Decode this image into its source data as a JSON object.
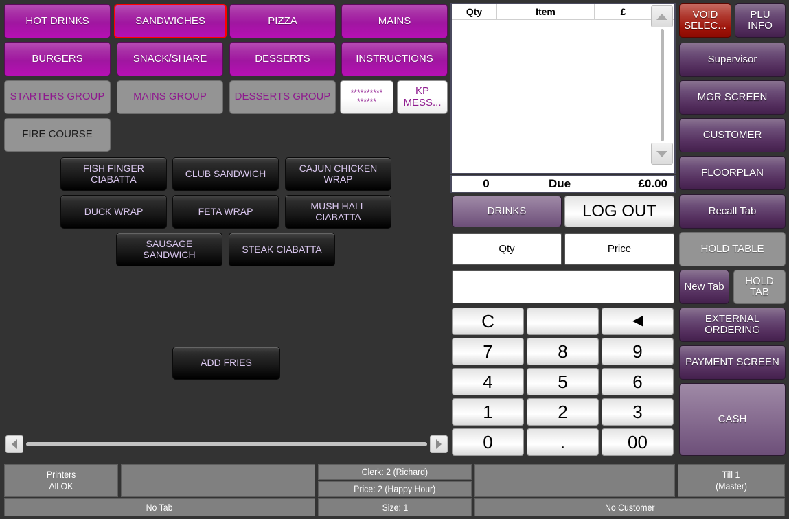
{
  "categories": [
    {
      "label": "HOT DRINKS",
      "selected": false
    },
    {
      "label": "SANDWICHES",
      "selected": true
    },
    {
      "label": "PIZZA",
      "selected": false
    },
    {
      "label": "MAINS",
      "selected": false
    },
    {
      "label": "BURGERS",
      "selected": false
    },
    {
      "label": "SNACK/SHARE",
      "selected": false
    },
    {
      "label": "DESSERTS",
      "selected": false
    },
    {
      "label": "INSTRUCTIONS",
      "selected": false
    }
  ],
  "groups": [
    {
      "label": "STARTERS GROUP"
    },
    {
      "label": "MAINS GROUP"
    },
    {
      "label": "DESSERTS GROUP"
    }
  ],
  "asterisk_button": {
    "line1": "**********",
    "line2": "******"
  },
  "kp_message_button": {
    "line1": "KP",
    "line2": "MESS..."
  },
  "fire_course_button": {
    "label": "FIRE COURSE"
  },
  "products": [
    {
      "line1": "FISH FINGER",
      "line2": "CIABATTA"
    },
    {
      "line1": "CLUB SANDWICH",
      "line2": ""
    },
    {
      "line1": "CAJUN CHICKEN",
      "line2": "WRAP"
    },
    {
      "line1": "DUCK WRAP",
      "line2": ""
    },
    {
      "line1": "FETA WRAP",
      "line2": ""
    },
    {
      "line1": "MUSH HALL",
      "line2": "CIABATTA"
    },
    {
      "line1": "SAUSAGE",
      "line2": "SANDWICH"
    },
    {
      "line1": "STEAK CIABATTA",
      "line2": ""
    }
  ],
  "add_fries_button": {
    "label": "ADD FRIES"
  },
  "receipt": {
    "columns": {
      "qty": "Qty",
      "item": "Item",
      "price": "£"
    },
    "rows": [],
    "total_qty": "0",
    "due_label": "Due",
    "due_amount": "£0.00"
  },
  "order_controls": {
    "drinks": "DRINKS",
    "log_out": "LOG OUT",
    "qty": "Qty",
    "price": "Price",
    "display_value": ""
  },
  "keypad": [
    {
      "label": "C"
    },
    {
      "label": ""
    },
    {
      "label": "◀",
      "icon": "backspace-arrow-icon"
    },
    {
      "label": "7"
    },
    {
      "label": "8"
    },
    {
      "label": "9"
    },
    {
      "label": "4"
    },
    {
      "label": "5"
    },
    {
      "label": "6"
    },
    {
      "label": "1"
    },
    {
      "label": "2"
    },
    {
      "label": "3"
    },
    {
      "label": "0"
    },
    {
      "label": "."
    },
    {
      "label": "00"
    }
  ],
  "sidebar": {
    "void_select": {
      "line1": "VOID",
      "line2": "SELEC..."
    },
    "plu_info": {
      "line1": "PLU",
      "line2": "INFO"
    },
    "supervisor": "Supervisor",
    "mgr_screen": "MGR SCREEN",
    "customer": "CUSTOMER",
    "floorplan": "FLOORPLAN",
    "recall_tab": "Recall Tab",
    "hold_table": "HOLD TABLE",
    "new_tab": "New Tab",
    "hold_tab": {
      "line1": "HOLD",
      "line2": "TAB"
    },
    "external_ordering": {
      "line1": "EXTERNAL",
      "line2": "ORDERING"
    },
    "payment_screen": "PAYMENT SCREEN",
    "cash": "CASH"
  },
  "status_bar": {
    "printers": {
      "line1": "Printers",
      "line2": "All OK"
    },
    "blank_left": "",
    "clerk": "Clerk: 2 (Richard)",
    "price_level": "Price: 2 (Happy Hour)",
    "blank_right": "",
    "till": {
      "line1": "Till 1",
      "line2": "(Master)"
    },
    "no_tab": "No Tab",
    "size": "Size: 1",
    "no_customer": "No Customer"
  },
  "colors": {
    "background": "#333333",
    "category_purple": "#a016a0",
    "sidebar_purple": "#55305f",
    "void_red": "#9d1208",
    "group_grey": "#949494",
    "status_grey": "#808080",
    "product_text": "#d9c6ee",
    "selection_outline": "#ff0000"
  }
}
